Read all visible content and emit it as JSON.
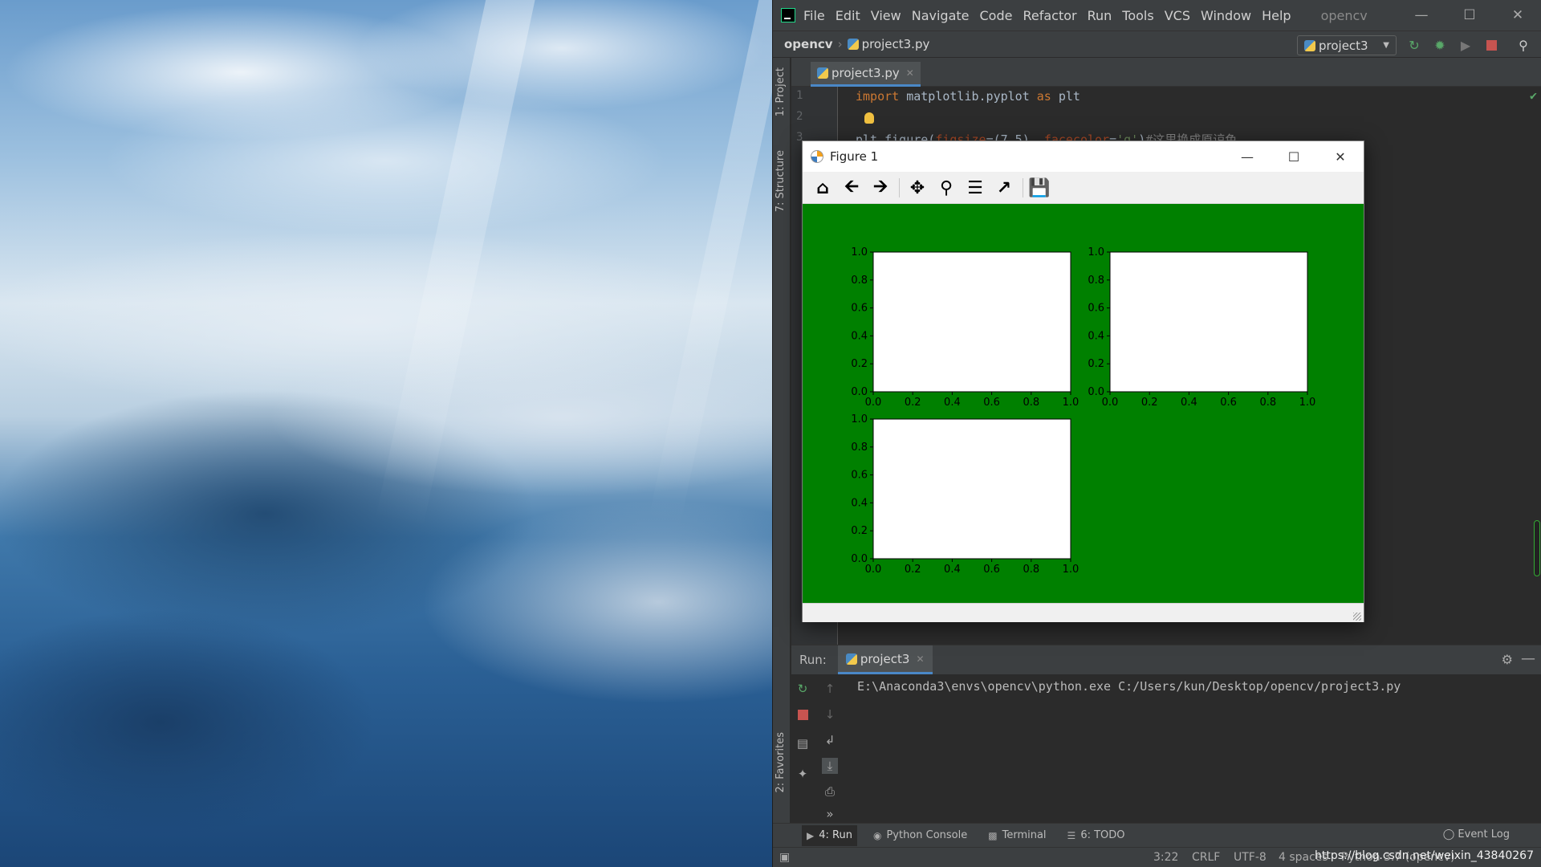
{
  "ide": {
    "menu": [
      "File",
      "Edit",
      "View",
      "Navigate",
      "Code",
      "Refactor",
      "Run",
      "Tools",
      "VCS",
      "Window",
      "Help"
    ],
    "window_title": "opencv",
    "breadcrumb": {
      "project": "opencv",
      "file": "project3.py"
    },
    "run_config": "project3",
    "side_tabs": {
      "project": "1: Project",
      "structure": "7: Structure",
      "favorites": "2: Favorites"
    },
    "editor_tab": "project3.py",
    "code": {
      "line1": {
        "num": "1",
        "kw1": "import",
        "mid": " matplotlib.pyplot ",
        "kw2": "as",
        "end": " plt"
      },
      "line2": {
        "num": "2"
      },
      "line3": {
        "num": "3",
        "start": "plt.figure(",
        "param1": "figsize",
        "eq1": "=(7,5), ",
        "param2": "facecolor",
        "eq2": "=",
        "str": "'g'",
        "end": ")",
        "comment": "#这里换成原谅色"
      }
    },
    "run_panel": {
      "label": "Run:",
      "tab": "project3",
      "console": "E:\\Anaconda3\\envs\\opencv\\python.exe C:/Users/kun/Desktop/opencv/project3.py"
    },
    "bottom_tabs": [
      "4: Run",
      "Python Console",
      "Terminal",
      "6: TODO"
    ],
    "event_log": "Event Log",
    "status": {
      "position": "3:22",
      "line_sep": "CRLF",
      "encoding": "UTF-8",
      "indent": "4 spaces",
      "interpreter": "Python 3.7 (opencv)"
    },
    "watermark": "https://blog.csdn.net/weixin_43840267"
  },
  "figure": {
    "title": "Figure 1",
    "toolbar": [
      "home-icon",
      "back-icon",
      "forward-icon",
      "pan-icon",
      "zoom-icon",
      "configure-subplots-icon",
      "edit-axes-icon",
      "save-icon"
    ],
    "facecolor": "#008000"
  },
  "chart_data": [
    {
      "type": "scatter",
      "subplot": 1,
      "xlim": [
        0,
        1
      ],
      "ylim": [
        0,
        1
      ],
      "xticks": [
        "0.0",
        "0.2",
        "0.4",
        "0.6",
        "0.8",
        "1.0"
      ],
      "yticks": [
        "0.0",
        "0.2",
        "0.4",
        "0.6",
        "0.8",
        "1.0"
      ],
      "x": [],
      "y": []
    },
    {
      "type": "scatter",
      "subplot": 2,
      "xlim": [
        0,
        1
      ],
      "ylim": [
        0,
        1
      ],
      "xticks": [
        "0.0",
        "0.2",
        "0.4",
        "0.6",
        "0.8",
        "1.0"
      ],
      "yticks": [
        "0.0",
        "0.2",
        "0.4",
        "0.6",
        "0.8",
        "1.0"
      ],
      "x": [],
      "y": []
    },
    {
      "type": "scatter",
      "subplot": 3,
      "xlim": [
        0,
        1
      ],
      "ylim": [
        0,
        1
      ],
      "xticks": [
        "0.0",
        "0.2",
        "0.4",
        "0.6",
        "0.8",
        "1.0"
      ],
      "yticks": [
        "0.0",
        "0.2",
        "0.4",
        "0.6",
        "0.8",
        "1.0"
      ],
      "x": [],
      "y": []
    }
  ]
}
